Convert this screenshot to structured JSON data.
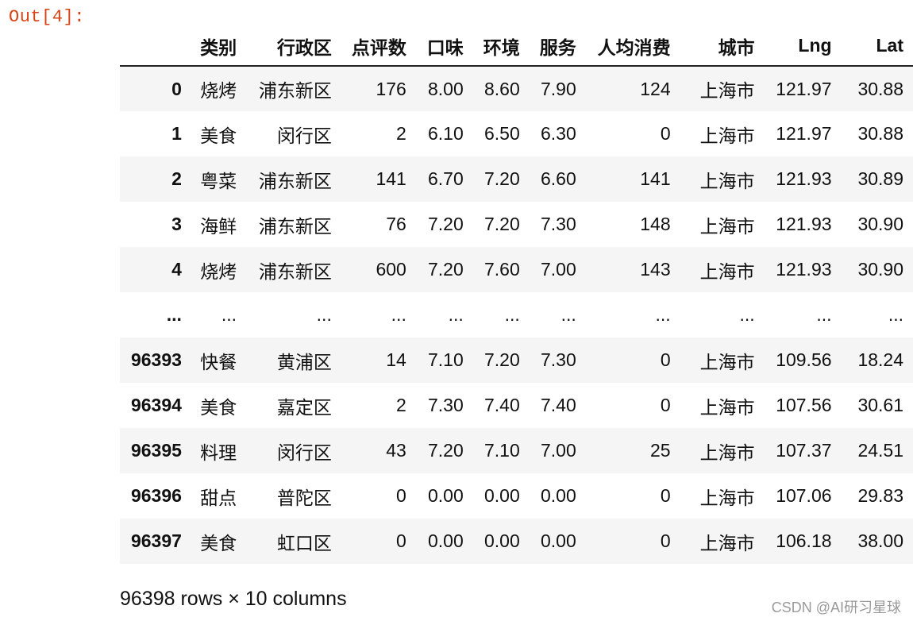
{
  "prompt": {
    "label": "Out[4]:"
  },
  "dataframe": {
    "columns": [
      "",
      "类别",
      "行政区",
      "点评数",
      "口味",
      "环境",
      "服务",
      "人均消费",
      "城市",
      "Lng",
      "Lat"
    ],
    "rows": [
      [
        "0",
        "烧烤",
        "浦东新区",
        "176",
        "8.00",
        "8.60",
        "7.90",
        "124",
        "上海市",
        "121.97",
        "30.88"
      ],
      [
        "1",
        "美食",
        "闵行区",
        "2",
        "6.10",
        "6.50",
        "6.30",
        "0",
        "上海市",
        "121.97",
        "30.88"
      ],
      [
        "2",
        "粤菜",
        "浦东新区",
        "141",
        "6.70",
        "7.20",
        "6.60",
        "141",
        "上海市",
        "121.93",
        "30.89"
      ],
      [
        "3",
        "海鲜",
        "浦东新区",
        "76",
        "7.20",
        "7.20",
        "7.30",
        "148",
        "上海市",
        "121.93",
        "30.90"
      ],
      [
        "4",
        "烧烤",
        "浦东新区",
        "600",
        "7.20",
        "7.60",
        "7.00",
        "143",
        "上海市",
        "121.93",
        "30.90"
      ],
      [
        "...",
        "...",
        "...",
        "...",
        "...",
        "...",
        "...",
        "...",
        "...",
        "...",
        "..."
      ],
      [
        "96393",
        "快餐",
        "黄浦区",
        "14",
        "7.10",
        "7.20",
        "7.30",
        "0",
        "上海市",
        "109.56",
        "18.24"
      ],
      [
        "96394",
        "美食",
        "嘉定区",
        "2",
        "7.30",
        "7.40",
        "7.40",
        "0",
        "上海市",
        "107.56",
        "30.61"
      ],
      [
        "96395",
        "料理",
        "闵行区",
        "43",
        "7.20",
        "7.10",
        "7.00",
        "25",
        "上海市",
        "107.37",
        "24.51"
      ],
      [
        "96396",
        "甜点",
        "普陀区",
        "0",
        "0.00",
        "0.00",
        "0.00",
        "0",
        "上海市",
        "107.06",
        "29.83"
      ],
      [
        "96397",
        "美食",
        "虹口区",
        "0",
        "0.00",
        "0.00",
        "0.00",
        "0",
        "上海市",
        "106.18",
        "38.00"
      ]
    ],
    "shape_text": "96398 rows × 10 columns"
  },
  "watermark": {
    "text": "CSDN @AI研习星球"
  }
}
